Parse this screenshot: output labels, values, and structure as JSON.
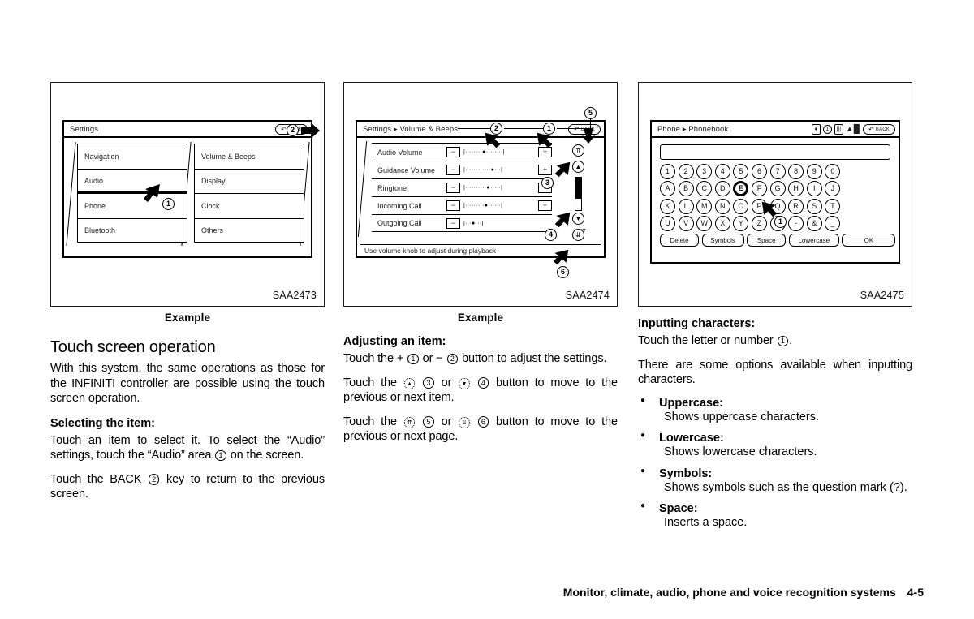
{
  "figures": [
    {
      "id": "figure-settings-menu",
      "code": "SAA2473",
      "caption": "Example",
      "screen": {
        "title": "Settings",
        "back_label": "BACK",
        "left_items": [
          "Navigation",
          "Audio",
          "Phone",
          "Bluetooth"
        ],
        "right_items": [
          "Volume & Beeps",
          "Display",
          "Clock",
          "Others"
        ]
      },
      "callouts": [
        "1",
        "2"
      ]
    },
    {
      "id": "figure-volume-beeps",
      "code": "SAA2474",
      "caption": "Example",
      "screen": {
        "title": "Settings ▸ Volume & Beeps",
        "back_label": "BACK",
        "rows": [
          {
            "label": "Audio Volume",
            "minus": "−",
            "plus": "+",
            "bar": "|········●········|"
          },
          {
            "label": "Guidance Volume",
            "minus": "−",
            "plus": "+",
            "bar": "|············●···|"
          },
          {
            "label": "Ringtone",
            "minus": "−",
            "plus": "+",
            "bar": "|··········●·····|"
          },
          {
            "label": "Incoming Call",
            "minus": "−",
            "plus": "+",
            "bar": "|·········●······|"
          },
          {
            "label": "Outgoing Call",
            "minus": "−",
            "plus": "+",
            "bar": "|···●···|"
          }
        ],
        "page_indicator": "1/7",
        "footnote": "Use volume knob to adjust during playback",
        "scroll_buttons": [
          "⇈",
          "▲",
          "▼",
          "⇊"
        ]
      },
      "callouts": [
        "1",
        "2",
        "3",
        "4",
        "5",
        "6"
      ]
    },
    {
      "id": "figure-phonebook-keyboard",
      "code": "SAA2475",
      "caption": "",
      "screen": {
        "title": "Phone ▸ Phonebook",
        "back_label": "BACK",
        "status_icons": [
          "bluetooth-icon",
          "clock-icon",
          "battery-icon",
          "signal-icon"
        ],
        "input_value": "",
        "key_rows": [
          [
            "1",
            "2",
            "3",
            "4",
            "5",
            "6",
            "7",
            "8",
            "9",
            "0"
          ],
          [
            "A",
            "B",
            "C",
            "D",
            "E",
            "F",
            "G",
            "H",
            "I",
            "J"
          ],
          [
            "K",
            "L",
            "M",
            "N",
            "O",
            "P",
            "Q",
            "R",
            "S",
            "T"
          ],
          [
            "U",
            "V",
            "W",
            "X",
            "Y",
            "Z",
            "'",
            "-",
            "&",
            "_"
          ]
        ],
        "selected_key": "E",
        "action_keys": [
          "Delete",
          "Symbols",
          "Space",
          "Lowercase",
          "OK"
        ]
      },
      "callouts": [
        "1"
      ]
    }
  ],
  "columns": {
    "left": {
      "heading": "Touch screen operation",
      "intro": "With this system, the same operations as those for the INFINITI controller are possible using the touch screen operation.",
      "sub_heading": "Selecting the item:",
      "para_select_a": "Touch an item to select it. To select the “Audio” settings, touch the “Audio” area",
      "para_select_b": "on the screen.",
      "para_back_a": "Touch the BACK",
      "para_back_b": "key to return to the previous screen.",
      "marker_audio": "1",
      "marker_back": "2"
    },
    "middle": {
      "sub_heading": "Adjusting an item:",
      "adjust_a": "Touch the +",
      "adjust_b": "or −",
      "adjust_c": "button to adjust the settings.",
      "item_a": "Touch the",
      "item_b": "or",
      "item_c": "button to move to the previous or next item.",
      "page_a": "Touch the",
      "page_b": "or",
      "page_c": "button to move to the previous or next page.",
      "m1": "1",
      "m2": "2",
      "m3": "3",
      "m4": "4",
      "m5": "5",
      "m6": "6",
      "icon_up": "▲",
      "icon_down": "▼",
      "icon_pgup": "⇈",
      "icon_pgdn": "⇊"
    },
    "right": {
      "sub_heading": "Inputting characters:",
      "touch_a": "Touch the letter or number",
      "touch_b": ".",
      "marker_key": "1",
      "options_intro": "There are some options available when inputting characters.",
      "options": [
        {
          "name": "Uppercase:",
          "desc": "Shows uppercase characters."
        },
        {
          "name": "Lowercase:",
          "desc": "Shows lowercase characters."
        },
        {
          "name": "Symbols:",
          "desc": "Shows symbols such as the question mark (?)."
        },
        {
          "name": "Space:",
          "desc": "Inserts a space."
        }
      ]
    }
  },
  "footer": {
    "title": "Monitor, climate, audio, phone and voice recognition systems",
    "page": "4-5"
  }
}
